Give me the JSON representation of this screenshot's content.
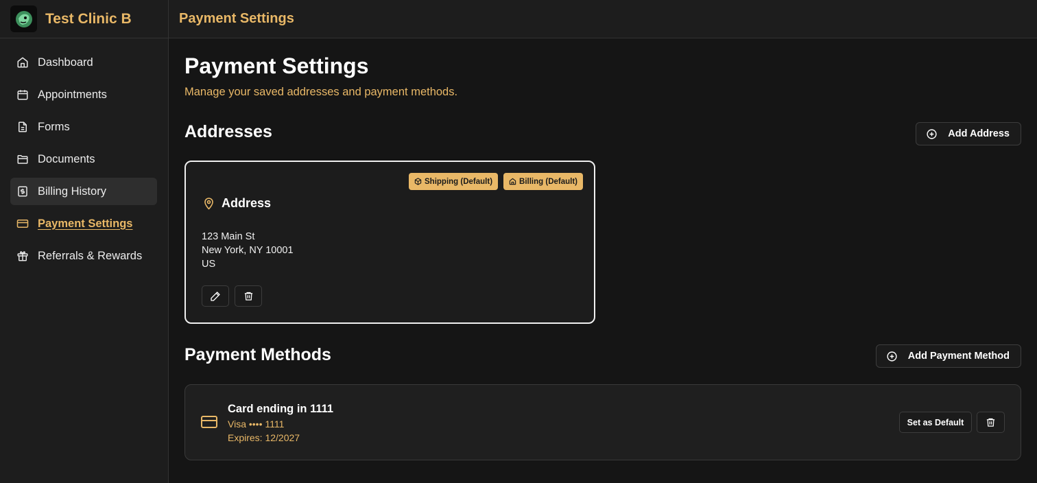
{
  "brand": {
    "name": "Test Clinic B",
    "logo_icon": "dragon-logo-icon"
  },
  "topbar": {
    "title": "Payment Settings"
  },
  "sidebar": {
    "items": [
      {
        "label": "Dashboard",
        "icon": "home-icon"
      },
      {
        "label": "Appointments",
        "icon": "calendar-icon"
      },
      {
        "label": "Forms",
        "icon": "document-icon"
      },
      {
        "label": "Documents",
        "icon": "folder-icon"
      },
      {
        "label": "Billing History",
        "icon": "receipt-icon",
        "state": "hovered"
      },
      {
        "label": "Payment Settings",
        "icon": "credit-card-icon",
        "state": "active"
      },
      {
        "label": "Referrals & Rewards",
        "icon": "gift-icon"
      }
    ]
  },
  "page": {
    "title": "Payment Settings",
    "subtitle": "Manage your saved addresses and payment methods."
  },
  "addresses": {
    "title": "Addresses",
    "add_label": "Add Address",
    "card": {
      "badges": [
        "Shipping (Default)",
        "Billing (Default)"
      ],
      "heading": "Address",
      "lines": [
        "123 Main St",
        "New York, NY 10001",
        "US"
      ]
    }
  },
  "payment_methods": {
    "title": "Payment Methods",
    "add_label": "Add Payment Method",
    "card": {
      "title": "Card ending in 1111",
      "brand_line": "Visa •••• 1111",
      "expires": "Expires: 12/2027",
      "set_default_label": "Set as Default"
    }
  },
  "colors": {
    "accent": "#e9b867",
    "background": "#151515",
    "surface": "#1d1d1d"
  }
}
